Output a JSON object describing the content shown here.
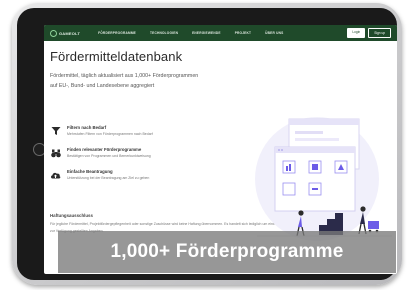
{
  "navbar": {
    "logo_text": "GAMEOLT",
    "links": [
      "FÖRDERPROGRAMME",
      "TECHNOLOGIEN",
      "ENERGIEWENDE",
      "PROJEKT",
      "ÜBER UNS"
    ],
    "login_label": "Login",
    "signup_label": "Sign up"
  },
  "page": {
    "title": "Fördermitteldatenbank",
    "intro": "Fördermittel, täglich aktualisiert aus 1,000+ Förderprogrammen auf EU-, Bund- und Landesebene aggregiert",
    "features": [
      {
        "icon": "filter-icon",
        "title": "Filtern nach Bedarf",
        "desc": "Mehrstufen Filtern von Förderprogrammen nach Bedarf"
      },
      {
        "icon": "binoculars-icon",
        "title": "Finden relevanter Förderprogramme",
        "desc": "Bestätigen von Programmen und Bemerkunktweisung"
      },
      {
        "icon": "cloud-upload-icon",
        "title": "Einfache Beantragung",
        "desc": "Unterstützung bei der Beantragung am Ziel zu geben"
      }
    ],
    "sub_heading": "Haftungsausschluss",
    "sub_text": "Für jegliche Fördermittel, Projektfördergepflegenheit oder sonstige Zuschüsse wird keine Haftung übernommen. Es handelt sich lediglich um eine Aggregation aus extern zur Verfügung gestellten Angaben."
  },
  "caption": "1,000+ Förderprogramme",
  "colors": {
    "navbar": "#1f4a2a",
    "accent": "#2e7d3e",
    "illustration_purple": "#6c5ce7"
  }
}
